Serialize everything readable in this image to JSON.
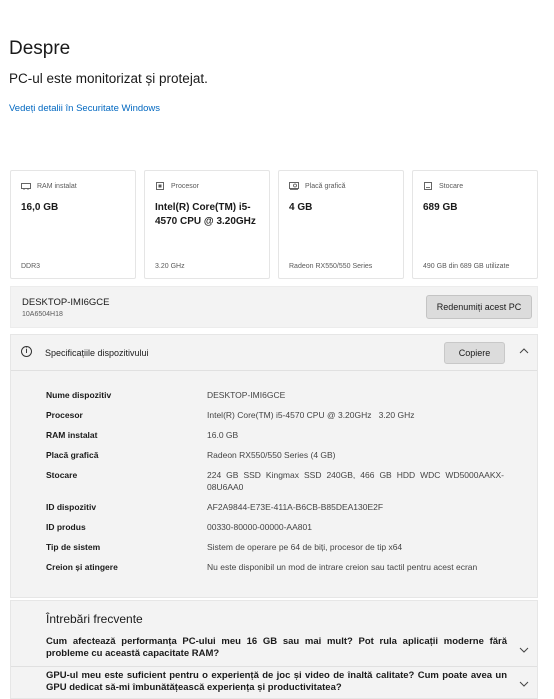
{
  "header": {
    "title": "Despre",
    "subtitle": "PC-ul este monitorizat și protejat.",
    "security_link": "Vedeți detalii în Securitate Windows"
  },
  "cards": [
    {
      "icon": "ram-icon",
      "label": "RAM instalat",
      "value": "16,0 GB",
      "footer": "DDR3"
    },
    {
      "icon": "processor-icon",
      "label": "Procesor",
      "value": "Intel(R) Core(TM) i5-4570 CPU @ 3.20GHz",
      "footer": "3.20 GHz"
    },
    {
      "icon": "graphics-card-icon",
      "label": "Placă grafică",
      "value": "4 GB",
      "footer": "Radeon RX550/550 Series"
    },
    {
      "icon": "storage-icon",
      "label": "Stocare",
      "value": "689 GB",
      "footer": "490 GB din 689 GB utilizate"
    }
  ],
  "device": {
    "name": "DESKTOP-IMI6GCE",
    "id": "10A6504H18",
    "rename_label": "Redenumiți acest PC"
  },
  "specs": {
    "title": "Specificațiile dispozitivului",
    "copy_label": "Copiere",
    "rows": [
      {
        "key": "Nume dispozitiv",
        "value": "DESKTOP-IMI6GCE"
      },
      {
        "key": "Procesor",
        "value": "Intel(R) Core(TM) i5-4570 CPU @ 3.20GHz   3.20 GHz"
      },
      {
        "key": "RAM instalat",
        "value": "16.0 GB"
      },
      {
        "key": "Placă grafică",
        "value": "Radeon RX550/550 Series (4 GB)"
      },
      {
        "key": "Stocare",
        "value": "224 GB SSD Kingmax SSD 240GB, 466 GB HDD WDC WD5000AAKX-08U6AA0"
      },
      {
        "key": "ID dispozitiv",
        "value": "AF2A9844-E73E-411A-B6CB-B85DEA130E2F"
      },
      {
        "key": "ID produs",
        "value": "00330-80000-00000-AA801"
      },
      {
        "key": "Tip de sistem",
        "value": "Sistem de operare pe 64 de biți, procesor de tip x64"
      },
      {
        "key": "Creion și atingere",
        "value": "Nu este disponibil un mod de intrare creion sau tactil pentru acest ecran"
      }
    ]
  },
  "faq": {
    "title": "Întrebări frecvente",
    "items": [
      {
        "question": "Cum afectează performanța PC-ului meu 16 GB sau mai mult? Pot rula aplicații moderne fără probleme cu această capacitate RAM?"
      },
      {
        "question": "GPU-ul meu este suficient pentru o experiență de joc și video de înaltă calitate? Cum poate avea un GPU dedicat să-mi îmbunătățească experiența și productivitatea?"
      }
    ]
  },
  "colors": {
    "link": "#0067c0",
    "panel_bg": "#f3f3f3",
    "button_bg": "#dcdcdc"
  }
}
